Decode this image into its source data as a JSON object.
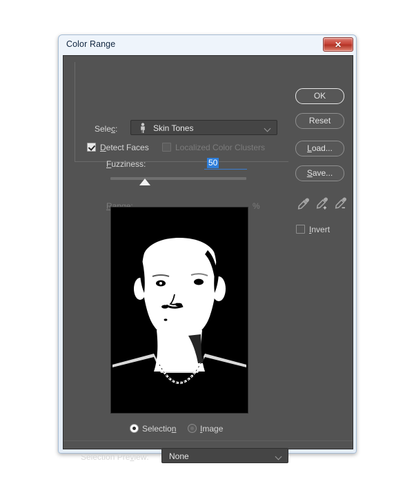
{
  "window": {
    "title": "Color Range",
    "close_icon": "close-icon",
    "close_glyph": "✕"
  },
  "select_row": {
    "label": "Select:",
    "label_prefix": "Sele",
    "label_accel": "c",
    "label_suffix": ":",
    "value": "Skin Tones",
    "icon": "person-icon",
    "caret": "chevron-down-icon"
  },
  "detect_faces": {
    "label": "Detect Faces",
    "label_accel": "D",
    "label_rest": "etect Faces",
    "checked": true
  },
  "localized_color_clusters": {
    "label": "Localized Color Clusters",
    "checked": false,
    "disabled": true
  },
  "fuzziness": {
    "label": "Fuzziness:",
    "label_accel": "F",
    "label_rest": "uzziness:",
    "value": "50",
    "slider_percent": 25,
    "min": 0,
    "max": 200
  },
  "range": {
    "label": "Range:",
    "label_accel": "R",
    "label_rest": "ange:",
    "value": "",
    "unit": "%",
    "disabled": true
  },
  "preview": {
    "mode": "selection-mask",
    "description": "Black and white selection mask of a person's head and shoulders with a chain necklace",
    "background_color": "#000000",
    "mask_color": "#ffffff"
  },
  "preview_radios": {
    "selection": {
      "label": "Selection",
      "label_head": "Selectio",
      "label_accel": "n",
      "selected": true
    },
    "image": {
      "label": "Image",
      "label_accel": "I",
      "label_rest": "mage",
      "selected": false
    }
  },
  "selection_preview": {
    "label": "Selection Preview:",
    "label_head": "Selection Pre",
    "label_accel": "v",
    "label_rest": "iew:",
    "value": "None",
    "caret": "chevron-down-icon"
  },
  "buttons": {
    "ok": {
      "label": "OK",
      "is_default": true
    },
    "reset": {
      "label": "Reset"
    },
    "load": {
      "label": "Load...",
      "label_accel": "L",
      "label_rest": "oad..."
    },
    "save": {
      "label": "Save...",
      "label_accel": "S",
      "label_rest": "ave..."
    }
  },
  "eyedroppers": [
    {
      "name": "eyedropper-sample",
      "title": "Eyedropper"
    },
    {
      "name": "eyedropper-add",
      "title": "Add to Sample"
    },
    {
      "name": "eyedropper-subtract",
      "title": "Subtract from Sample"
    }
  ],
  "invert": {
    "label": "Invert",
    "label_accel": "I",
    "label_rest": "nvert",
    "checked": false
  },
  "colors": {
    "dialog_background": "#535353",
    "title_bar": "#e8f0f9",
    "close_button": "#c33f32",
    "accent_selection": "#2f7fdc",
    "text": "#d6d6d6",
    "text_disabled": "#7c7c7c"
  }
}
